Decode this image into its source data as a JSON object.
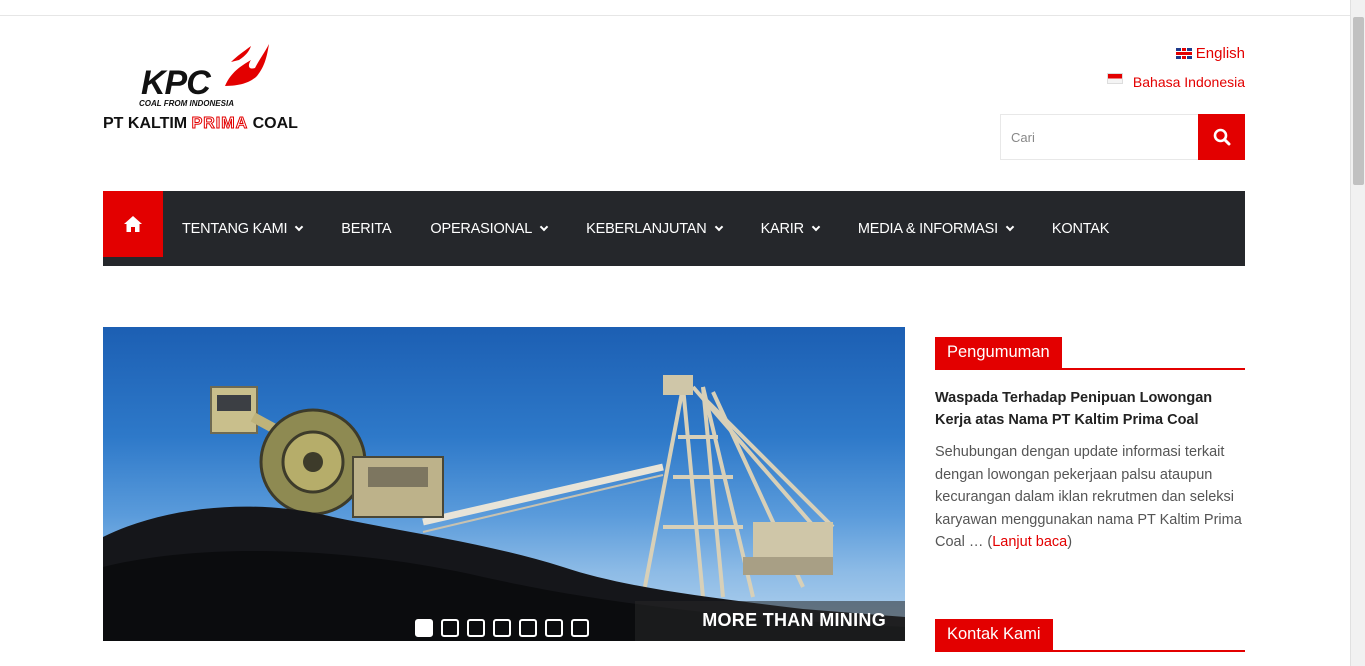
{
  "brand": {
    "logo_text": "KPC",
    "tagline": "COAL FROM INDONESIA",
    "company_prefix": "PT KALTIM ",
    "company_accent": "PRIMA",
    "company_suffix": " COAL"
  },
  "languages": [
    {
      "label": "English",
      "flag": "uk-flag-icon"
    },
    {
      "label": "Bahasa Indonesia",
      "flag": "id-flag-icon"
    }
  ],
  "search": {
    "placeholder": "Cari"
  },
  "nav": {
    "home_icon": "home-icon",
    "items": [
      {
        "label": "TENTANG KAMI",
        "dropdown": true
      },
      {
        "label": "BERITA",
        "dropdown": false
      },
      {
        "label": "OPERASIONAL",
        "dropdown": true
      },
      {
        "label": "KEBERLANJUTAN",
        "dropdown": true
      },
      {
        "label": "KARIR",
        "dropdown": true
      },
      {
        "label": "MEDIA & INFORMASI",
        "dropdown": true
      },
      {
        "label": "KONTAK",
        "dropdown": false
      }
    ]
  },
  "slider": {
    "caption": "MORE THAN MINING",
    "slide_count": 7,
    "active_index": 0
  },
  "sidebar": {
    "announcement": {
      "heading": "Pengumuman",
      "title": "Waspada Terhadap Penipuan Lowongan Kerja atas Nama PT Kaltim Prima Coal",
      "body": "Sehubungan dengan update informasi terkait dengan lowongan pekerjaan palsu ataupun kecurangan dalam iklan rekrutmen dan seleksi karyawan menggunakan nama PT Kaltim Prima Coal … (",
      "read_more": "Lanjut baca",
      "body_end": ")"
    },
    "contact": {
      "heading": "Kontak Kami"
    }
  },
  "colors": {
    "accent": "#e30000",
    "nav_bg": "#25272b"
  }
}
